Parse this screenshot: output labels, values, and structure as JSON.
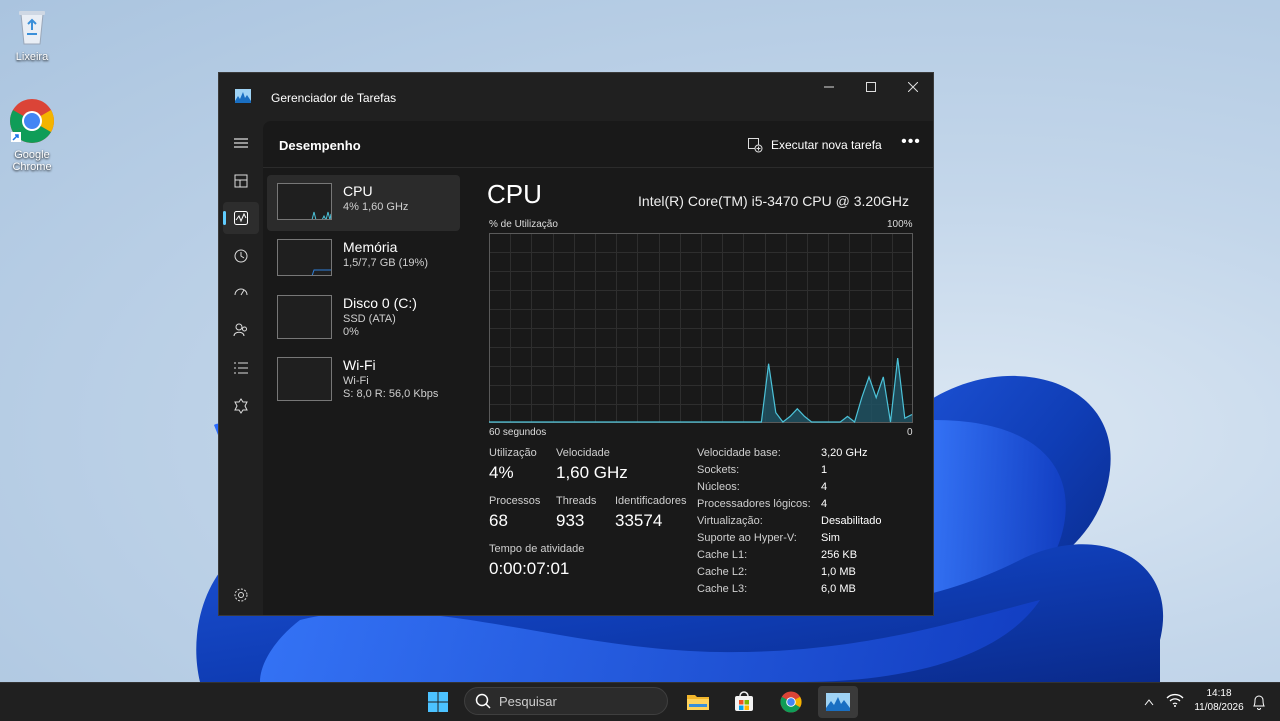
{
  "desktop": {
    "icons": [
      {
        "label": "Lixeira",
        "icon": "recycle-bin-icon"
      },
      {
        "label": "Google Chrome",
        "icon": "chrome-icon"
      }
    ]
  },
  "window": {
    "title": "Gerenciador de Tarefas",
    "controls": [
      "minimize-icon",
      "maximize-icon",
      "close-icon"
    ]
  },
  "nav": {
    "items": [
      {
        "icon": "hamburger-menu-icon"
      },
      {
        "icon": "processes-icon"
      },
      {
        "icon": "performance-icon",
        "active": true
      },
      {
        "icon": "app-history-icon"
      },
      {
        "icon": "startup-apps-icon"
      },
      {
        "icon": "users-icon"
      },
      {
        "icon": "details-icon"
      },
      {
        "icon": "services-icon"
      },
      {
        "icon": "settings-icon"
      }
    ]
  },
  "header": {
    "title": "Desempenho",
    "run_task": "Executar nova tarefa",
    "more": "•••"
  },
  "perf_list": [
    {
      "name": "CPU",
      "sub1": "4% 1,60 GHz",
      "sub2": ""
    },
    {
      "name": "Memória",
      "sub1": "1,5/7,7 GB (19%)",
      "sub2": ""
    },
    {
      "name": "Disco 0 (C:)",
      "sub1": "SSD (ATA)",
      "sub2": "0%"
    },
    {
      "name": "Wi-Fi",
      "sub1": "Wi-Fi",
      "sub2": "S: 8,0 R: 56,0 Kbps"
    }
  ],
  "detail": {
    "title": "CPU",
    "model": "Intel(R) Core(TM) i5-3470 CPU @ 3.20GHz",
    "util_label": "% de Utilização",
    "util_max": "100%",
    "axis_left": "60 segundos",
    "axis_right": "0",
    "stats": {
      "utilizacao": {
        "label": "Utilização",
        "value": "4%"
      },
      "velocidade": {
        "label": "Velocidade",
        "value": "1,60 GHz"
      },
      "processos": {
        "label": "Processos",
        "value": "68"
      },
      "threads": {
        "label": "Threads",
        "value": "933"
      },
      "identificadores": {
        "label": "Identificadores",
        "value": "33574"
      },
      "tempo": {
        "label": "Tempo de atividade",
        "value": "0:00:07:01"
      }
    },
    "specs": [
      {
        "k": "Velocidade base:",
        "v": "3,20 GHz"
      },
      {
        "k": "Sockets:",
        "v": "1"
      },
      {
        "k": "Núcleos:",
        "v": "4"
      },
      {
        "k": "Processadores lógicos:",
        "v": "4"
      },
      {
        "k": "Virtualização:",
        "v": "Desabilitado"
      },
      {
        "k": "Suporte ao Hyper-V:",
        "v": "Sim"
      },
      {
        "k": "Cache L1:",
        "v": "256 KB"
      },
      {
        "k": "Cache L2:",
        "v": "1,0 MB"
      },
      {
        "k": "Cache L3:",
        "v": "6,0 MB"
      }
    ],
    "cpu_history": [
      0,
      0,
      0,
      0,
      0,
      0,
      0,
      0,
      0,
      0,
      0,
      0,
      0,
      0,
      0,
      0,
      0,
      0,
      0,
      0,
      0,
      0,
      0,
      0,
      0,
      0,
      0,
      0,
      0,
      0,
      0,
      0,
      0,
      0,
      0,
      0,
      0,
      0,
      0,
      31,
      5,
      0,
      3,
      7,
      3,
      0,
      0,
      0,
      0,
      0,
      3,
      0,
      13,
      24,
      13,
      24,
      0,
      34,
      2,
      4
    ]
  },
  "taskbar": {
    "search_placeholder": "Pesquisar",
    "time": "14:18",
    "date": "11/08/2026",
    "colors": {
      "accent": "#60cdff",
      "graph_line": "#4cc2d8",
      "graph_fill": "#1f5566"
    }
  }
}
